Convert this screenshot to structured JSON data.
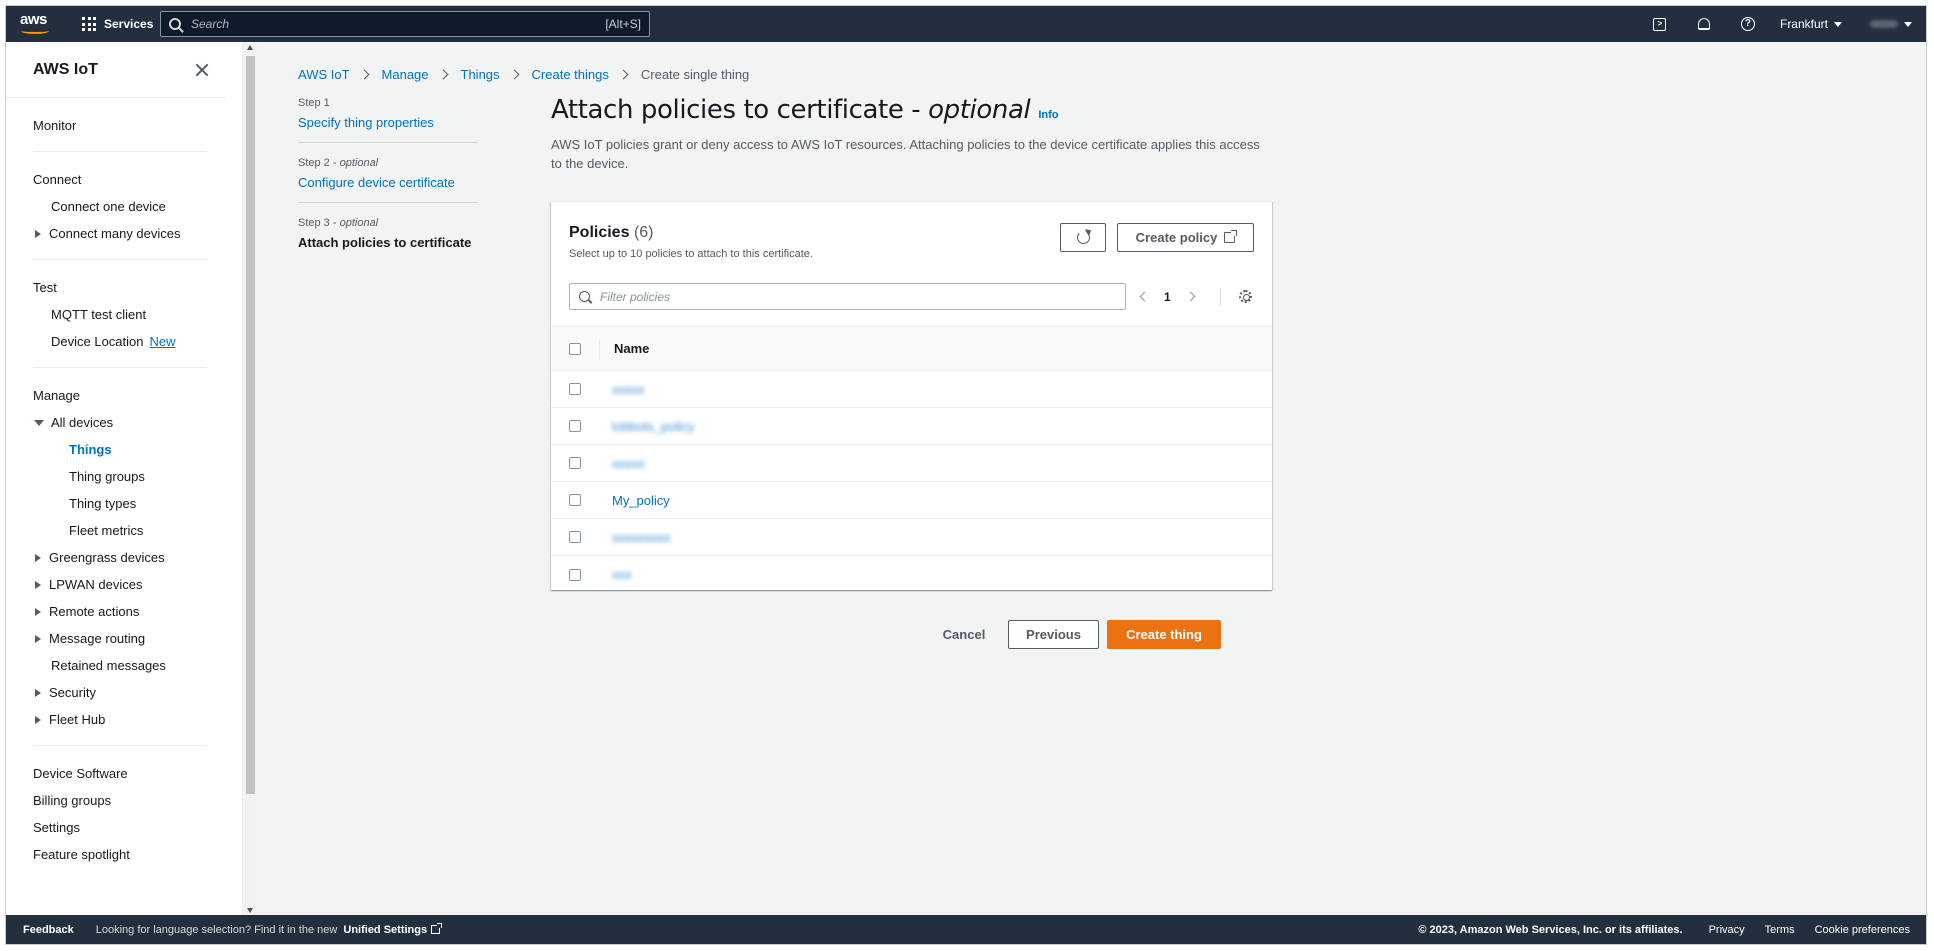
{
  "topnav": {
    "logo_text": "aws",
    "services_label": "Services",
    "search_placeholder": "Search",
    "search_shortcut": "[Alt+S]",
    "region_label": "Frankfurt"
  },
  "sidebar": {
    "title": "AWS IoT",
    "monitor": "Monitor",
    "connect": {
      "heading": "Connect",
      "connect_one": "Connect one device",
      "connect_many": "Connect many devices"
    },
    "test": {
      "heading": "Test",
      "mqtt": "MQTT test client",
      "device_location": "Device Location",
      "new_badge": "New"
    },
    "manage": {
      "heading": "Manage",
      "all_devices": "All devices",
      "things": "Things",
      "thing_groups": "Thing groups",
      "thing_types": "Thing types",
      "fleet_metrics": "Fleet metrics",
      "greengrass": "Greengrass devices",
      "lpwan": "LPWAN devices",
      "remote_actions": "Remote actions",
      "message_routing": "Message routing",
      "retained_messages": "Retained messages",
      "security": "Security",
      "fleet_hub": "Fleet Hub"
    },
    "bottom": {
      "device_software": "Device Software",
      "billing_groups": "Billing groups",
      "settings": "Settings",
      "feature_spotlight": "Feature spotlight"
    }
  },
  "breadcrumb": {
    "items": [
      "AWS IoT",
      "Manage",
      "Things",
      "Create things"
    ],
    "current": "Create single thing"
  },
  "steps": [
    {
      "num": "Step 1",
      "optional": "",
      "label": "Specify thing properties"
    },
    {
      "num": "Step 2",
      "optional": "optional",
      "label": "Configure device certificate"
    },
    {
      "num": "Step 3",
      "optional": "optional",
      "label": "Attach policies to certificate"
    }
  ],
  "step_separator": " - ",
  "page": {
    "title": "Attach policies to certificate - ",
    "title_optional": "optional",
    "info": "Info",
    "description": "AWS IoT policies grant or deny access to AWS IoT resources. Attaching policies to the device certificate applies this access to the device."
  },
  "policies": {
    "title": "Policies",
    "count": "(6)",
    "subtitle": "Select up to 10 policies to attach to this certificate.",
    "create_policy_label": "Create policy",
    "filter_placeholder": "Filter policies",
    "page_number": "1",
    "column_name": "Name",
    "rows": [
      {
        "name": "xxxxx",
        "blurred": true
      },
      {
        "name": "lobbots_policy",
        "blurred": true
      },
      {
        "name": "xxxxx",
        "blurred": true
      },
      {
        "name": "My_policy",
        "blurred": false
      },
      {
        "name": "xxxxxxxxx",
        "blurred": true
      },
      {
        "name": "xxx",
        "blurred": true
      }
    ]
  },
  "actions": {
    "cancel": "Cancel",
    "previous": "Previous",
    "create": "Create thing"
  },
  "footer": {
    "feedback": "Feedback",
    "language_note": "Looking for language selection? Find it in the new",
    "unified_settings": "Unified Settings",
    "copyright": "© 2023, Amazon Web Services, Inc. or its affiliates.",
    "privacy": "Privacy",
    "terms": "Terms",
    "cookie_prefs": "Cookie preferences"
  },
  "colors": {
    "nav_bg": "#232f3e",
    "link": "#0073bb",
    "primary": "#ec7211",
    "page_bg": "#f2f3f3"
  }
}
